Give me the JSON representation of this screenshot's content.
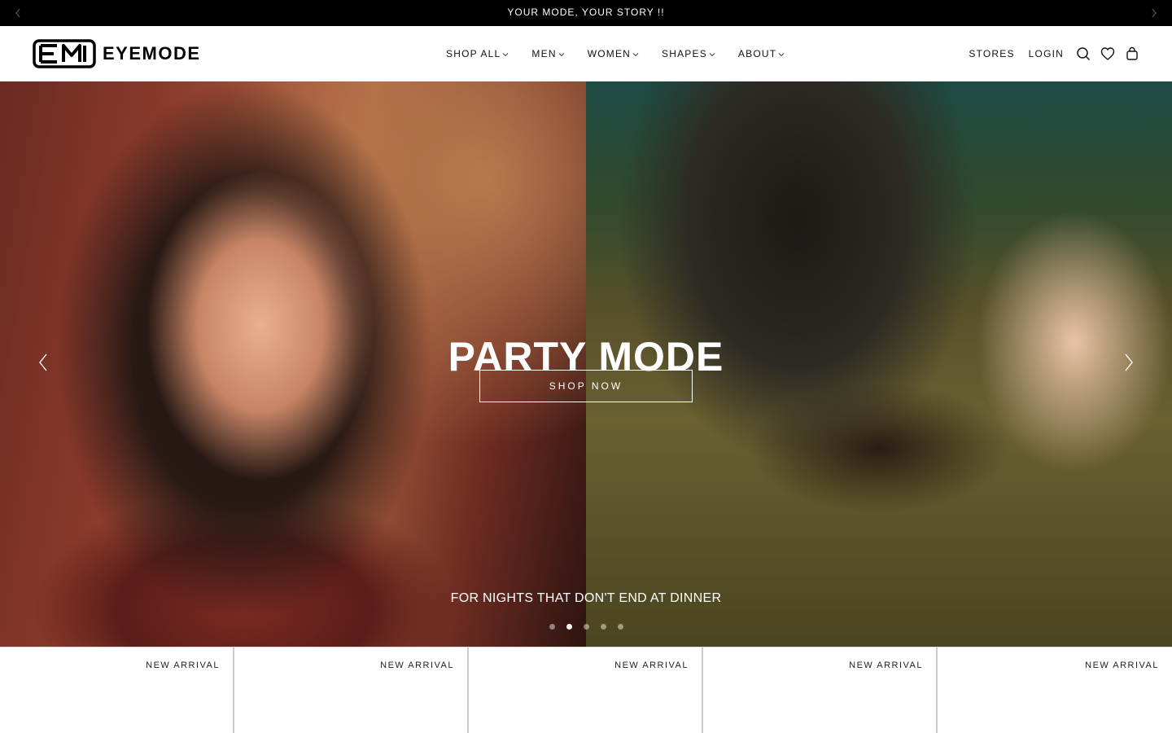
{
  "announcement": {
    "text": "YOUR MODE, YOUR STORY !!"
  },
  "header": {
    "logo_text": "EYEMODE",
    "nav": [
      {
        "label": "SHOP ALL"
      },
      {
        "label": "MEN"
      },
      {
        "label": "WOMEN"
      },
      {
        "label": "SHAPES"
      },
      {
        "label": "ABOUT"
      }
    ],
    "stores_label": "STORES",
    "login_label": "LOGIN"
  },
  "hero": {
    "title": "PARTY MODE",
    "cta_label": "SHOP NOW",
    "caption": "FOR NIGHTS THAT DON'T END AT DINNER",
    "slides_total": 5,
    "active_slide": 2
  },
  "products": [
    {
      "badge": "NEW ARRIVAL"
    },
    {
      "badge": "NEW ARRIVAL"
    },
    {
      "badge": "NEW ARRIVAL"
    },
    {
      "badge": "NEW ARRIVAL"
    },
    {
      "badge": "NEW ARRIVAL"
    }
  ],
  "colors": {
    "announce_bg": "#000000",
    "text": "#111111",
    "hero_text": "#ffffff"
  }
}
